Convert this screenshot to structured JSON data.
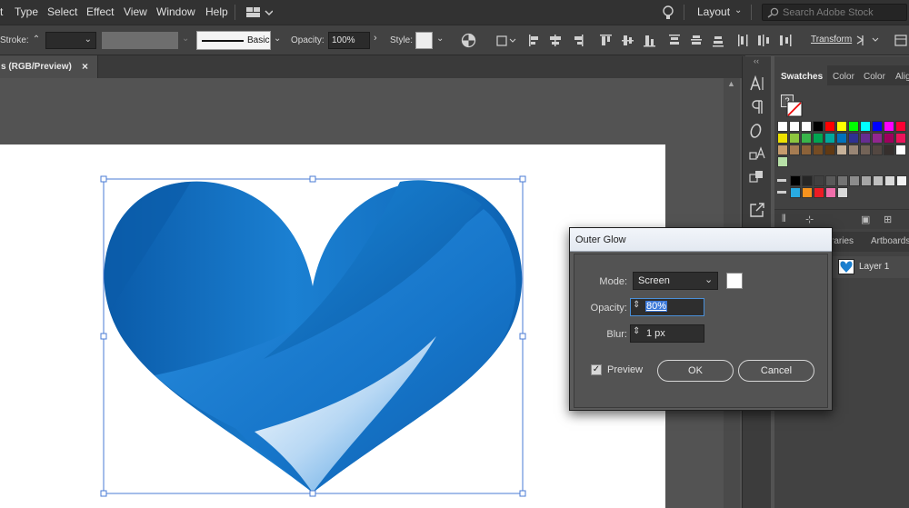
{
  "menubar": {
    "cut_left": "t",
    "items": [
      "Type",
      "Select",
      "Effect",
      "View",
      "Window",
      "Help"
    ],
    "layout_label": "Layout",
    "search_placeholder": "Search Adobe Stock"
  },
  "control_bar": {
    "stroke_label": "Stroke:",
    "brush_label": "Basic",
    "opacity_label": "Opacity:",
    "opacity_value": "100%",
    "style_label": "Style:",
    "transform_label": "Transform"
  },
  "document": {
    "tab_title": "s (RGB/Preview)",
    "tab_close": "×"
  },
  "panels": {
    "tabs": [
      "Swatches",
      "Color",
      "Color",
      "Alig"
    ],
    "lower_tabs": [
      "raries",
      "Artboards"
    ],
    "layer_name": "Layer 1",
    "swatch_rows": [
      [
        "#ffffff",
        "#ffffff",
        "#ffffff",
        "#000000",
        "#ff0000",
        "#ffff00",
        "#00ff00",
        "#00ffff",
        "#0000ff",
        "#ff00ff",
        "#ff0033"
      ],
      [
        "#ede100",
        "#8dc63f",
        "#39b54a",
        "#00a651",
        "#00a99d",
        "#0072bc",
        "#2e3192",
        "#662d91",
        "#92278f",
        "#9e005d",
        "#ed145b"
      ],
      [
        "#c69c6d",
        "#a67c52",
        "#8c6239",
        "#754c24",
        "#603913",
        "#c7b299",
        "#998675",
        "#736357",
        "#534741",
        "#362f2d",
        "#ffffff"
      ],
      [
        "#b7e0a7"
      ],
      [
        "#000000",
        "#262626",
        "#404040",
        "#595959",
        "#737373",
        "#8c8c8c",
        "#a6a6a6",
        "#bfbfbf",
        "#d9d9d9",
        "#f2f2f2"
      ],
      [
        "#29abe2",
        "#f7931e",
        "#ed1c24",
        "#f06eaa",
        "#d9d9d9"
      ]
    ],
    "colors": {
      "dialog_title_bg": "#e6ecf3",
      "selection": "#4a7bd4",
      "heart_blue": "#1a7fd0"
    }
  },
  "dialog": {
    "title": "Outer Glow",
    "mode_label": "Mode:",
    "mode_value": "Screen",
    "opacity_label": "Opacity:",
    "opacity_value": "80%",
    "blur_label": "Blur:",
    "blur_value": "1 px",
    "preview_label": "Preview",
    "preview_checked": true,
    "ok_label": "OK",
    "cancel_label": "Cancel"
  },
  "icons": [
    "lightbulb-icon",
    "search-icon",
    "arrange-documents-icon",
    "character-icon",
    "paragraph-icon",
    "opentype-icon",
    "glyphs-icon",
    "export-icon",
    "recolor-icon",
    "align-icon"
  ]
}
